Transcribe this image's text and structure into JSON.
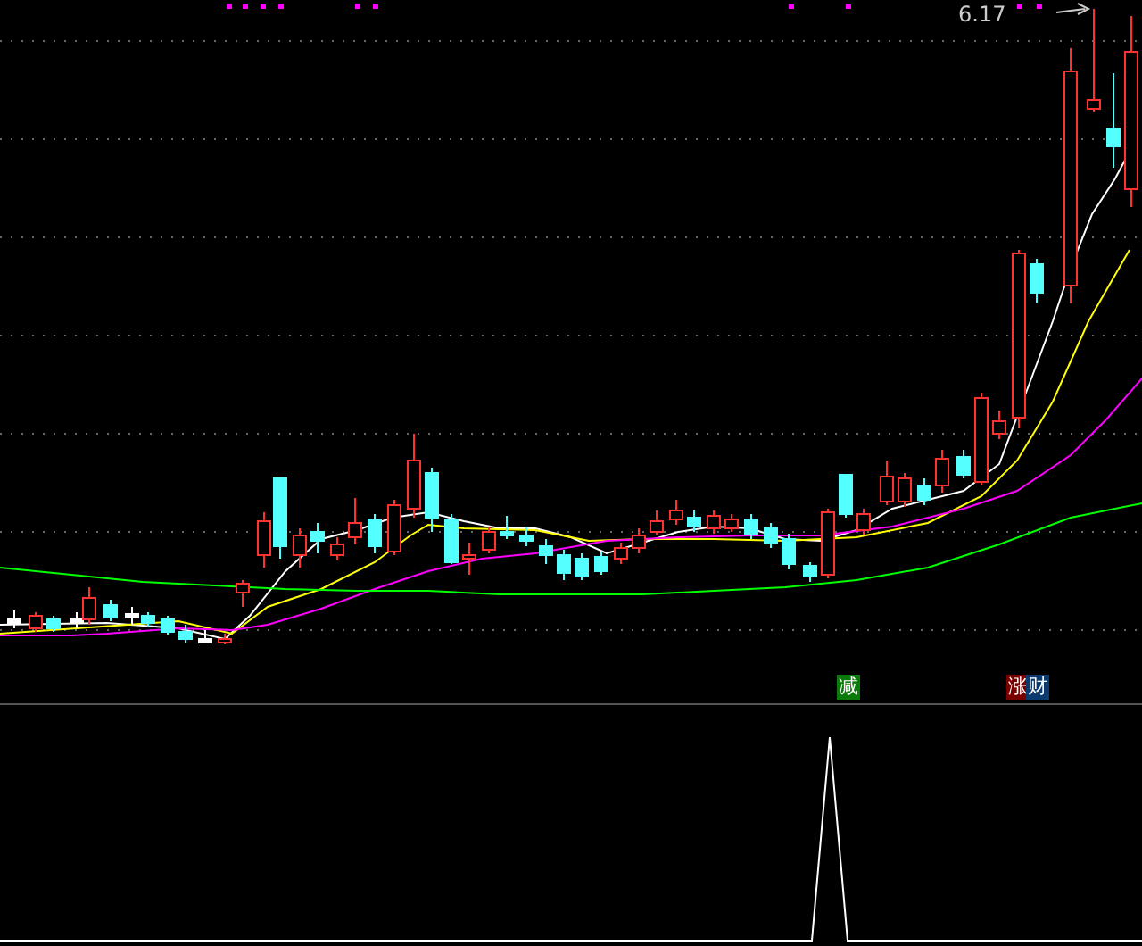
{
  "price_panel": {
    "high_label": "6.17"
  },
  "signals": [
    {
      "text": "减",
      "color": "#0a7a0a"
    },
    {
      "text": "涨",
      "color": "#7a0000"
    },
    {
      "text": "财",
      "color": "#0a3a6e"
    }
  ]
}
